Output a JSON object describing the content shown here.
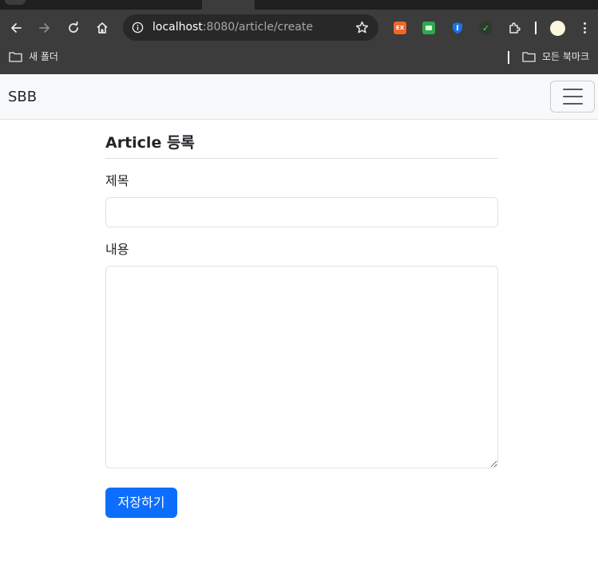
{
  "browser": {
    "url_host": "localhost",
    "url_rest": ":8080/article/create",
    "extensions": {
      "ex_label": "EX"
    },
    "bookmarks_bar": {
      "left_folder": "새 폴더",
      "right_folder": "모든 북마크"
    }
  },
  "navbar": {
    "brand": "SBB"
  },
  "form": {
    "page_title": "Article 등록",
    "subject_label": "제목",
    "subject_value": "",
    "content_label": "내용",
    "content_value": "",
    "save_label": "저장하기"
  },
  "colors": {
    "primary_button": "#0d6efd",
    "navbar_bg": "#f8f9fa",
    "browser_toolbar": "#3c3c3c"
  }
}
